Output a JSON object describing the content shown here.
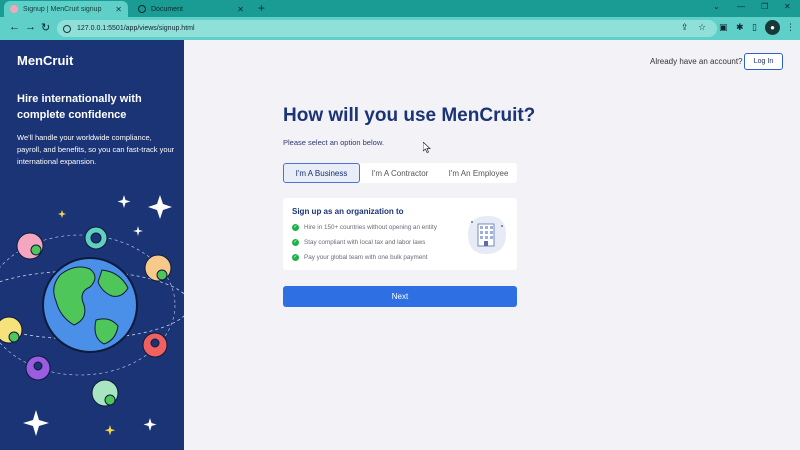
{
  "browser": {
    "tabs": [
      {
        "title": "Signup | MenCruit signup",
        "active": true
      },
      {
        "title": "Document",
        "active": false
      }
    ],
    "url": "127.0.0.1:5501/app/views/signup.html"
  },
  "brand": {
    "name": "MenCruit",
    "color": "#1b3476"
  },
  "left_panel": {
    "headline": "Hire internationally with complete confidence",
    "blurb": "We'll handle your worldwide compliance, payroll, and benefits, so you can fast-track your international expansion."
  },
  "header": {
    "account_prompt": "Already have an account?",
    "login_label": "Log In"
  },
  "signup": {
    "title": "How will you use MenCruit?",
    "subtitle": "Please select an option below.",
    "options": [
      {
        "label": "I'm A Business",
        "selected": true
      },
      {
        "label": "I'm A Contractor",
        "selected": false
      },
      {
        "label": "I'm An Employee",
        "selected": false
      }
    ],
    "card": {
      "title": "Sign up as an organization to",
      "bullets": [
        "Hire in 150+ countries without opening an entity",
        "Stay compliant with local tax and labor laws",
        "Pay your global team with one bulk payment"
      ]
    },
    "next_label": "Next",
    "accent": "#2f6fe4",
    "check_color": "#1bb247"
  }
}
